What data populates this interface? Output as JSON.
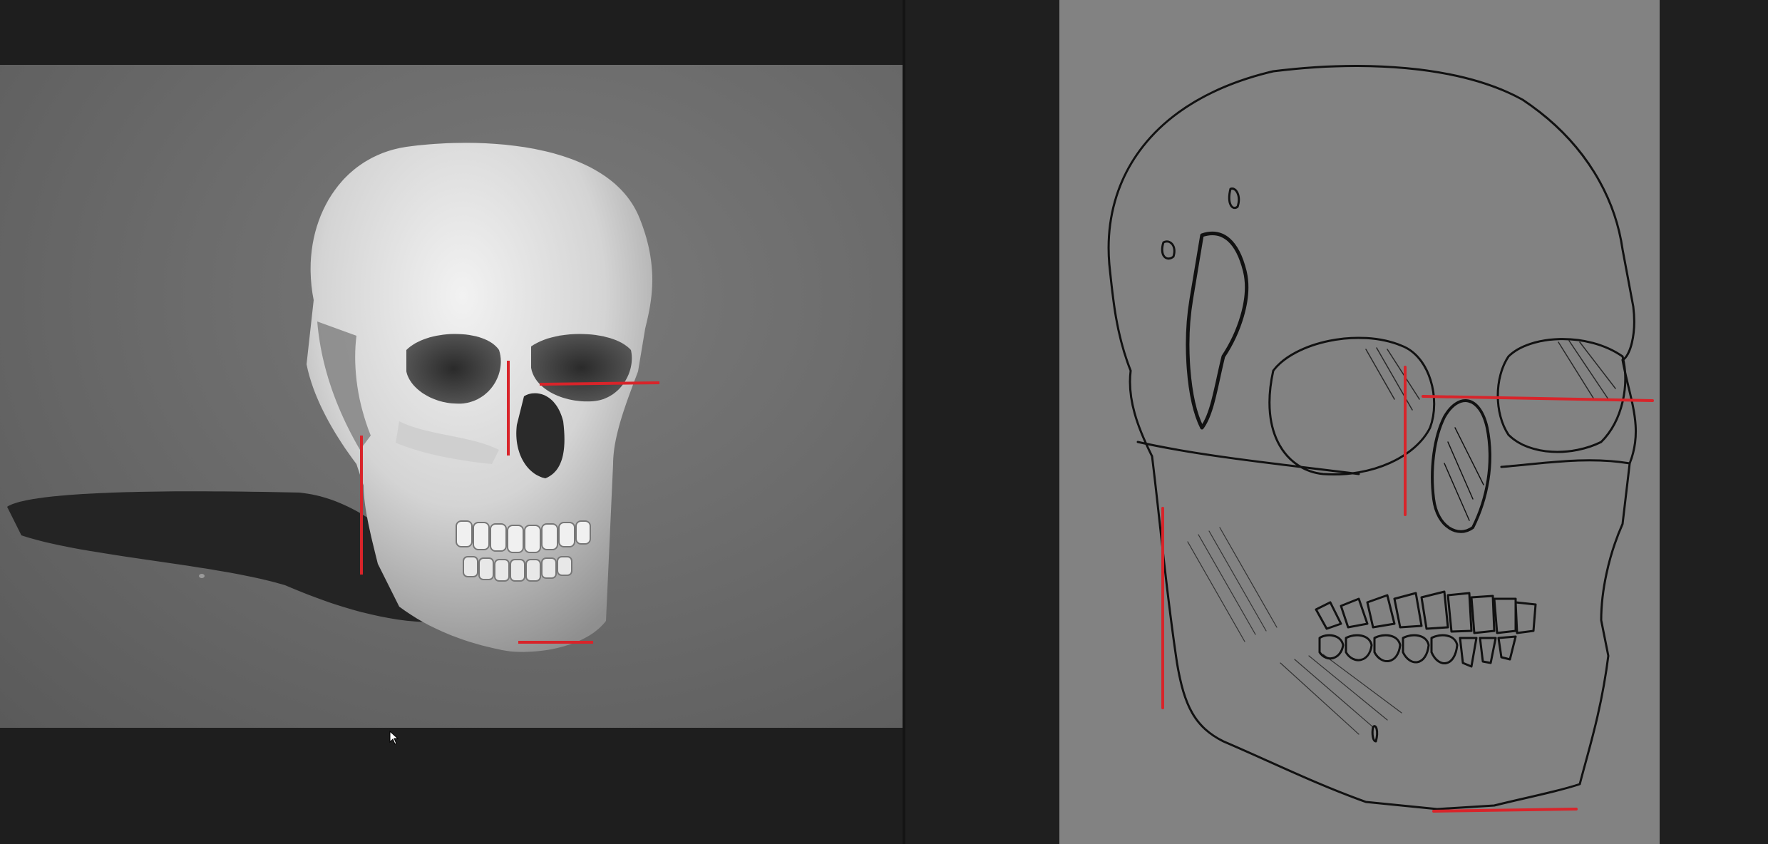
{
  "app": {
    "panels": [
      "reference-viewport",
      "drawing-canvas"
    ]
  },
  "colors": {
    "workspace_bg": "#1f1f1f",
    "viewport_bg": "#6c6c6c",
    "canvas_bg": "#828282",
    "guide_line": "#d8242a",
    "ink": "#111111",
    "bone_light": "#e6e6e6",
    "bone_shadow": "#9a9a9a",
    "cast_shadow": "#242424"
  },
  "icons": {
    "cursor": "mouse-pointer-icon"
  }
}
